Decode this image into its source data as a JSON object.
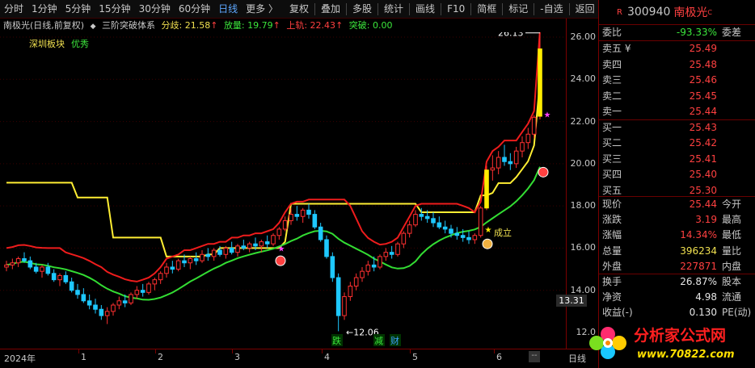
{
  "toolbar": {
    "left_items": [
      "分时",
      "1分钟",
      "5分钟",
      "15分钟",
      "30分钟",
      "60分钟",
      "日线",
      "更多 〉"
    ],
    "active": "日线",
    "right_items": [
      "复权",
      "叠加",
      "多股",
      "统计",
      "画线",
      "F10",
      "简框",
      "标记",
      "-自选",
      "返回"
    ]
  },
  "infobar": {
    "title": "南极光(日线,前复权)",
    "indicator_symbol": "◆",
    "indicator_name": "三阶突破体系",
    "fenqi_label": "分歧: 21.58",
    "fangliang_label": "放量: 19.79",
    "shanggui_label": "上轨: 22.43",
    "tupo_label": "突破: 0.00",
    "colors": {
      "fenqi": "#f0e050",
      "fangliang": "#3ce63c",
      "shanggui": "#ff4040",
      "tupo": "#3ce63c"
    }
  },
  "chart_labels": {
    "sector": "深圳板块",
    "sector_tag": "优秀",
    "high_marker": "26.13",
    "low_marker": "←12.06",
    "chengli": "成立",
    "event_die": "跌",
    "event_jian": "减",
    "event_cai": "财"
  },
  "price_axis": {
    "ticks": [
      "26.00",
      "24.00",
      "22.00",
      "20.00",
      "18.00",
      "16.00",
      "14.00",
      "12.0"
    ],
    "cursor_price": "13.31"
  },
  "time_axis": {
    "ticks": [
      "2024年",
      "1",
      "2",
      "3",
      "4",
      "5",
      "6"
    ],
    "end_button": "--",
    "period": "日线"
  },
  "quote": {
    "r_badge": "R",
    "code": "300940",
    "name": "南极光",
    "name_sup": "C",
    "weibi": {
      "label": "委比",
      "value": "-93.33%",
      "label2": "委差"
    },
    "asks": [
      {
        "label": "卖五 ¥",
        "price": "25.49"
      },
      {
        "label": "卖四",
        "price": "25.48"
      },
      {
        "label": "卖三",
        "price": "25.46"
      },
      {
        "label": "卖二",
        "price": "25.45"
      },
      {
        "label": "卖一",
        "price": "25.44"
      }
    ],
    "bids": [
      {
        "label": "买一",
        "price": "25.43"
      },
      {
        "label": "买二",
        "price": "25.42"
      },
      {
        "label": "买三",
        "price": "25.41"
      },
      {
        "label": "买四",
        "price": "25.40"
      },
      {
        "label": "买五",
        "price": "25.30"
      }
    ],
    "stats": [
      {
        "label": "现价",
        "value": "25.44",
        "label2": "今开",
        "color": "red"
      },
      {
        "label": "涨跌",
        "value": "3.19",
        "label2": "最高",
        "color": "red"
      },
      {
        "label": "涨幅",
        "value": "14.34%",
        "label2": "最低",
        "color": "red"
      },
      {
        "label": "总量",
        "value": "396234",
        "label2": "量比",
        "color": "yellow"
      },
      {
        "label": "外盘",
        "value": "227871",
        "label2": "内盘",
        "color": "red"
      }
    ],
    "stats2": [
      {
        "label": "换手",
        "value": "26.87%",
        "label2": "股本",
        "color": "white"
      },
      {
        "label": "净资",
        "value": "4.98",
        "label2": "流通",
        "color": "white"
      },
      {
        "label": "收益(-)",
        "value": "0.130",
        "label2": "PE(动)",
        "color": "white"
      }
    ]
  },
  "logo": {
    "title": "分析家公式网",
    "url": "www.70822.com"
  },
  "chart_data": {
    "type": "candlestick",
    "ylim": [
      11.8,
      26.6
    ],
    "y_ticks": [
      26,
      24,
      22,
      20,
      18,
      16,
      14,
      12
    ],
    "x_month_labels": [
      "2024年",
      "1",
      "2",
      "3",
      "4",
      "5",
      "6"
    ],
    "candles": [
      [
        15.1,
        15.4,
        14.9,
        15.2
      ],
      [
        15.2,
        15.5,
        15.0,
        15.3
      ],
      [
        15.3,
        15.6,
        15.1,
        15.5
      ],
      [
        15.5,
        15.8,
        15.3,
        15.4
      ],
      [
        15.4,
        15.6,
        15.0,
        15.1
      ],
      [
        15.1,
        15.3,
        14.8,
        14.9
      ],
      [
        14.9,
        15.2,
        14.6,
        15.1
      ],
      [
        15.1,
        15.3,
        14.7,
        14.8
      ],
      [
        14.8,
        15.0,
        14.4,
        14.5
      ],
      [
        14.5,
        14.8,
        14.2,
        14.7
      ],
      [
        14.7,
        14.9,
        14.3,
        14.4
      ],
      [
        14.4,
        14.6,
        13.9,
        14.0
      ],
      [
        14.0,
        14.3,
        13.6,
        13.8
      ],
      [
        13.8,
        14.1,
        13.4,
        13.5
      ],
      [
        13.5,
        13.8,
        13.1,
        13.3
      ],
      [
        13.3,
        13.6,
        12.9,
        13.1
      ],
      [
        13.1,
        13.3,
        12.6,
        12.8
      ],
      [
        12.8,
        13.2,
        12.4,
        13.0
      ],
      [
        13.0,
        13.4,
        12.8,
        13.3
      ],
      [
        13.3,
        13.7,
        13.1,
        13.5
      ],
      [
        13.5,
        13.8,
        13.2,
        13.4
      ],
      [
        13.4,
        13.9,
        13.3,
        13.8
      ],
      [
        13.8,
        14.2,
        13.6,
        14.0
      ],
      [
        14.0,
        14.3,
        13.7,
        13.9
      ],
      [
        13.9,
        14.4,
        13.8,
        14.3
      ],
      [
        14.3,
        14.6,
        14.0,
        14.5
      ],
      [
        14.5,
        14.9,
        14.3,
        14.8
      ],
      [
        14.8,
        15.3,
        14.6,
        15.1
      ],
      [
        15.1,
        15.4,
        14.8,
        15.0
      ],
      [
        15.0,
        15.5,
        14.9,
        15.4
      ],
      [
        15.4,
        15.7,
        15.1,
        15.3
      ],
      [
        15.3,
        15.6,
        15.0,
        15.5
      ],
      [
        15.5,
        15.8,
        15.2,
        15.4
      ],
      [
        15.4,
        15.9,
        15.3,
        15.7
      ],
      [
        15.7,
        16.0,
        15.4,
        15.6
      ],
      [
        15.6,
        16.0,
        15.4,
        15.9
      ],
      [
        15.9,
        16.1,
        15.6,
        15.7
      ],
      [
        15.7,
        16.1,
        15.5,
        16.0
      ],
      [
        16.0,
        16.3,
        15.7,
        15.8
      ],
      [
        15.8,
        16.2,
        15.6,
        16.1
      ],
      [
        16.1,
        16.4,
        15.9,
        16.0
      ],
      [
        16.0,
        16.3,
        15.8,
        16.2
      ],
      [
        16.2,
        16.5,
        15.9,
        16.1
      ],
      [
        16.1,
        16.4,
        15.8,
        16.3
      ],
      [
        16.3,
        16.6,
        16.0,
        16.2
      ],
      [
        16.2,
        16.7,
        16.1,
        16.6
      ],
      [
        16.6,
        17.0,
        16.4,
        16.9
      ],
      [
        16.9,
        17.5,
        16.8,
        17.3
      ],
      [
        17.3,
        17.9,
        17.1,
        17.6
      ],
      [
        17.6,
        18.0,
        17.3,
        17.5
      ],
      [
        17.5,
        17.9,
        17.2,
        17.8
      ],
      [
        17.8,
        18.1,
        17.4,
        17.6
      ],
      [
        17.6,
        17.8,
        16.9,
        17.0
      ],
      [
        17.0,
        17.2,
        16.3,
        16.4
      ],
      [
        16.4,
        16.6,
        15.5,
        15.6
      ],
      [
        15.6,
        15.8,
        14.4,
        14.6
      ],
      [
        14.6,
        14.8,
        12.06,
        12.8
      ],
      [
        12.8,
        13.9,
        12.6,
        13.7
      ],
      [
        13.7,
        14.4,
        13.5,
        14.2
      ],
      [
        14.2,
        14.8,
        14.0,
        14.6
      ],
      [
        14.6,
        15.1,
        14.4,
        14.9
      ],
      [
        14.9,
        15.4,
        14.7,
        15.2
      ],
      [
        15.2,
        15.6,
        14.9,
        15.1
      ],
      [
        15.1,
        15.7,
        15.0,
        15.6
      ],
      [
        15.6,
        16.0,
        15.4,
        15.8
      ],
      [
        15.8,
        16.1,
        15.5,
        15.7
      ],
      [
        15.7,
        16.3,
        15.6,
        16.2
      ],
      [
        16.2,
        16.8,
        16.0,
        16.7
      ],
      [
        16.7,
        17.3,
        16.5,
        17.1
      ],
      [
        17.1,
        17.8,
        17.0,
        17.6
      ],
      [
        17.6,
        17.9,
        17.3,
        17.5
      ],
      [
        17.5,
        17.8,
        17.2,
        17.4
      ],
      [
        17.4,
        17.7,
        17.0,
        17.2
      ],
      [
        17.2,
        17.5,
        16.9,
        17.0
      ],
      [
        17.0,
        17.3,
        16.7,
        16.9
      ],
      [
        16.9,
        17.1,
        16.5,
        16.7
      ],
      [
        16.7,
        17.0,
        16.4,
        16.6
      ],
      [
        16.6,
        16.9,
        16.3,
        16.5
      ],
      [
        16.5,
        16.8,
        16.2,
        16.4
      ],
      [
        16.4,
        16.7,
        16.2,
        16.6
      ],
      [
        16.6,
        18.0,
        16.5,
        17.9
      ],
      [
        17.9,
        19.9,
        17.8,
        19.7
      ],
      [
        19.7,
        20.4,
        19.2,
        19.8
      ],
      [
        19.8,
        20.6,
        19.5,
        20.3
      ],
      [
        20.3,
        20.9,
        19.9,
        20.1
      ],
      [
        20.1,
        20.5,
        19.7,
        20.0
      ],
      [
        20.0,
        20.8,
        19.8,
        20.6
      ],
      [
        20.6,
        21.3,
        20.3,
        21.0
      ],
      [
        21.0,
        21.7,
        20.7,
        21.4
      ],
      [
        21.4,
        22.3,
        21.2,
        22.2
      ],
      [
        22.25,
        26.13,
        22.1,
        25.44
      ]
    ]
  }
}
